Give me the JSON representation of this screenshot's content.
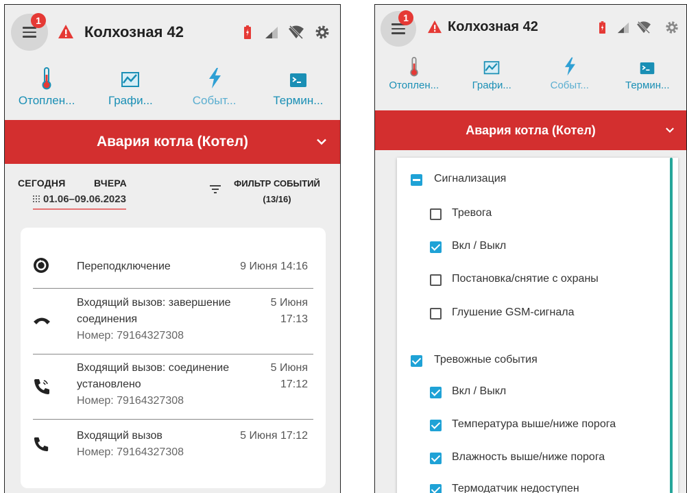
{
  "app": {
    "badge_count": "1",
    "location_title": "Колхозная 42",
    "colors": {
      "accent": "#1a8fb5",
      "alarm": "#d32f2f",
      "badge": "#e53935",
      "check": "#1fa2d6"
    }
  },
  "nav": [
    {
      "label": "Отоплен...",
      "icon": "thermometer-icon"
    },
    {
      "label": "Графи...",
      "icon": "chart-icon"
    },
    {
      "label": "Событ...",
      "icon": "lightning-icon"
    },
    {
      "label": "Термин...",
      "icon": "terminal-icon"
    }
  ],
  "alarm_banner": "Авария котла (Котел)",
  "left_screen": {
    "tabs": {
      "today": "СЕГОДНЯ",
      "yesterday": "ВЧЕРА"
    },
    "date_range": "01.06–09.06.2023",
    "filter": {
      "label": "ФИЛЬТР СОБЫТИЙ",
      "count": "(13/16)"
    },
    "events": [
      {
        "icon": "reconnect-icon",
        "text": "Переподключение",
        "time": "9 Июня 14:16"
      },
      {
        "icon": "call-end-icon",
        "text": "Входящий вызов: завершение соединения",
        "sub": "Номер: 79164327308",
        "time": "5 Июня 17:13"
      },
      {
        "icon": "call-connected-icon",
        "text": "Входящий вызов: соединение установлено",
        "sub": "Номер: 79164327308",
        "time": "5 Июня 17:12"
      },
      {
        "icon": "phone-icon",
        "text": "Входящий вызов",
        "sub": "Номер: 79164327308",
        "time": "5 Июня 17:12"
      }
    ]
  },
  "right_screen": {
    "groups": [
      {
        "label": "Сигнализация",
        "state": "partial",
        "items": [
          {
            "label": "Тревога",
            "checked": false
          },
          {
            "label": "Вкл / Выкл",
            "checked": true
          },
          {
            "label": "Постановка/снятие с охраны",
            "checked": false
          },
          {
            "label": "Глушение GSM-сигнала",
            "checked": false
          }
        ]
      },
      {
        "label": "Тревожные события",
        "state": "checked",
        "items": [
          {
            "label": "Вкл / Выкл",
            "checked": true
          },
          {
            "label": "Температура выше/ниже порога",
            "checked": true
          },
          {
            "label": "Влажность выше/ниже порога",
            "checked": true
          },
          {
            "label": "Термодатчик недоступен",
            "checked": true
          }
        ]
      }
    ]
  }
}
